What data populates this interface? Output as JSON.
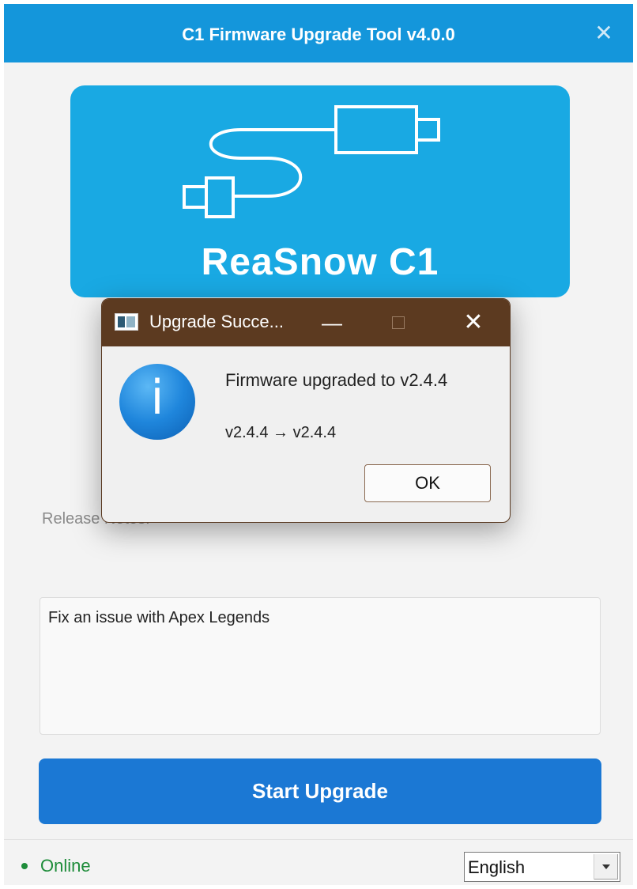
{
  "window": {
    "title": "C1 Firmware Upgrade Tool  v4.0.0",
    "close_icon": "close-icon"
  },
  "banner": {
    "brand": "ReaSnow C1",
    "icon": "usb-cable-icon",
    "color": "#19a9e3"
  },
  "release_notes": {
    "label": "Release Notes:",
    "content": "Fix an issue with Apex Legends"
  },
  "actions": {
    "start_label": "Start Upgrade",
    "color": "#1b78d4"
  },
  "status": {
    "text": "Online",
    "color": "#1e8c3a",
    "language": "English"
  },
  "dialog": {
    "title": "Upgrade Succe...",
    "message": "Firmware upgraded to v2.4.4",
    "version_change": "v2.4.4  →  v2.4.4",
    "ok_label": "OK",
    "icon": "info-icon",
    "title_color": "#5c3a20"
  }
}
